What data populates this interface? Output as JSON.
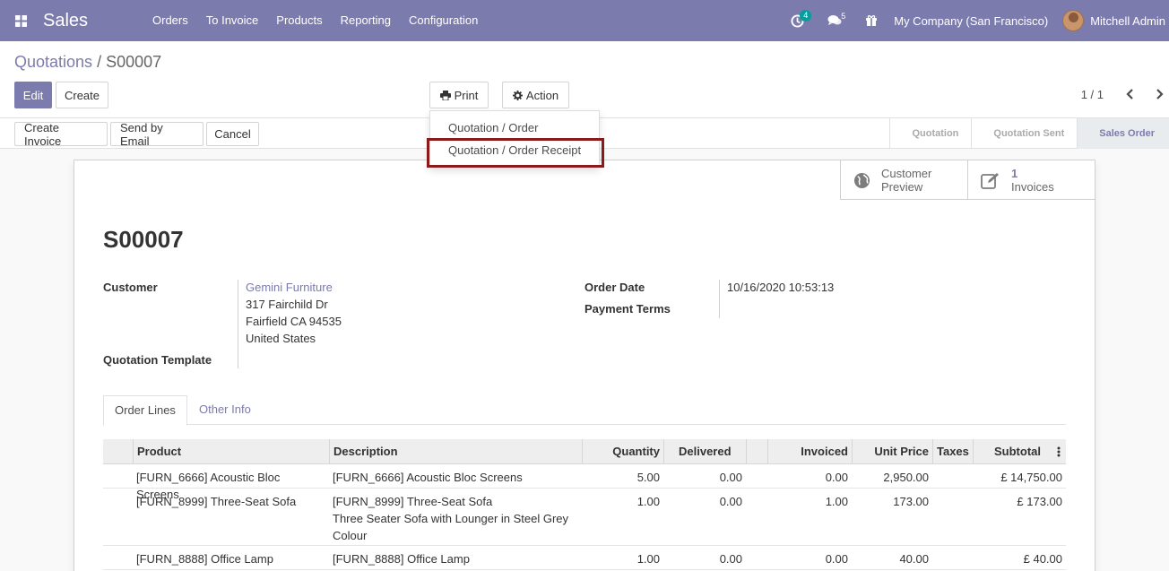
{
  "navbar": {
    "app_name": "Sales",
    "menu": [
      "Orders",
      "To Invoice",
      "Products",
      "Reporting",
      "Configuration"
    ],
    "activity_count": "4",
    "message_count": "5",
    "company": "My Company (San Francisco)",
    "user": "Mitchell Admin"
  },
  "breadcrumb": {
    "parent": "Quotations",
    "separator": "/",
    "current": "S00007"
  },
  "buttons": {
    "edit": "Edit",
    "create": "Create",
    "print": "Print",
    "action": "Action",
    "create_invoice": "Create Invoice",
    "send_email": "Send by Email",
    "cancel": "Cancel"
  },
  "pager": {
    "value": "1 / 1"
  },
  "print_menu": {
    "items": [
      "Quotation / Order",
      "Quotation / Order Receipt"
    ],
    "highlighted": "Quotation / Order Receipt"
  },
  "status": {
    "steps": [
      "Quotation",
      "Quotation Sent",
      "Sales Order"
    ],
    "active": "Sales Order"
  },
  "smart_buttons": {
    "preview": {
      "line1": "Customer",
      "line2": "Preview"
    },
    "invoices": {
      "count": "1",
      "label": "Invoices"
    }
  },
  "record": {
    "name": "S00007",
    "customer_label": "Customer",
    "customer": {
      "name": "Gemini Furniture",
      "street": "317 Fairchild Dr",
      "city": "Fairfield CA 94535",
      "country": "United States"
    },
    "template_label": "Quotation Template",
    "order_date_label": "Order Date",
    "order_date": "10/16/2020 10:53:13",
    "payment_terms_label": "Payment Terms"
  },
  "tabs": [
    "Order Lines",
    "Other Info"
  ],
  "table": {
    "headers": [
      "Product",
      "Description",
      "Quantity",
      "Delivered",
      "Invoiced",
      "Unit Price",
      "Taxes",
      "Subtotal"
    ],
    "rows": [
      {
        "product": "[FURN_6666] Acoustic Bloc Screens",
        "desc1": "[FURN_6666] Acoustic Bloc Screens",
        "desc2": "",
        "desc3": "",
        "qty": "5.00",
        "delivered": "0.00",
        "invoiced": "0.00",
        "price": "2,950.00",
        "taxes": "",
        "subtotal": "£ 14,750.00"
      },
      {
        "product": "[FURN_8999] Three-Seat Sofa",
        "desc1": "[FURN_8999] Three-Seat Sofa",
        "desc2": "Three Seater Sofa with Lounger in Steel Grey",
        "desc3": "Colour",
        "qty": "1.00",
        "delivered": "0.00",
        "invoiced": "1.00",
        "price": "173.00",
        "taxes": "",
        "subtotal": "£ 173.00"
      },
      {
        "product": "[FURN_8888] Office Lamp",
        "desc1": "[FURN_8888] Office Lamp",
        "desc2": "",
        "desc3": "",
        "qty": "1.00",
        "delivered": "0.00",
        "invoiced": "0.00",
        "price": "40.00",
        "taxes": "",
        "subtotal": "£ 40.00"
      }
    ]
  },
  "colors": {
    "brand": "#7c7bad",
    "highlight_border": "#8b1a1a",
    "badge": "#00a09d"
  }
}
